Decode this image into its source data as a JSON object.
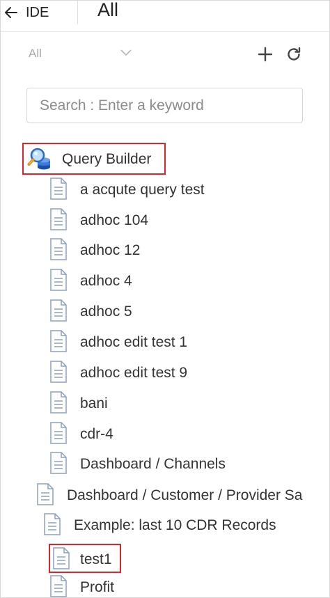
{
  "header": {
    "back_label": "IDE",
    "title": "All"
  },
  "filter": {
    "selected": "All"
  },
  "search": {
    "placeholder": "Search : Enter a keyword",
    "value": ""
  },
  "tree": {
    "root_label": "Query Builder",
    "items": [
      {
        "label": "a acqute query test"
      },
      {
        "label": "adhoc 104"
      },
      {
        "label": "adhoc 12"
      },
      {
        "label": "adhoc 4"
      },
      {
        "label": "adhoc 5"
      },
      {
        "label": "adhoc edit test 1"
      },
      {
        "label": "adhoc edit test 9"
      },
      {
        "label": "bani"
      },
      {
        "label": "cdr-4"
      },
      {
        "label": "Dashboard / Channels"
      },
      {
        "label": "Dashboard / Customer / Provider Sa"
      },
      {
        "label": "Example: last 10 CDR Records"
      },
      {
        "label": "test1"
      },
      {
        "label": "Profit"
      }
    ]
  },
  "colors": {
    "highlight": "#d9262c",
    "icon_stroke": "#8aa0bf"
  },
  "icons": {
    "back": "arrow-left-icon",
    "filter": "chevron-down-icon",
    "add": "plus-icon",
    "refresh": "refresh-icon",
    "root": "query-builder-icon",
    "item": "document-icon"
  }
}
